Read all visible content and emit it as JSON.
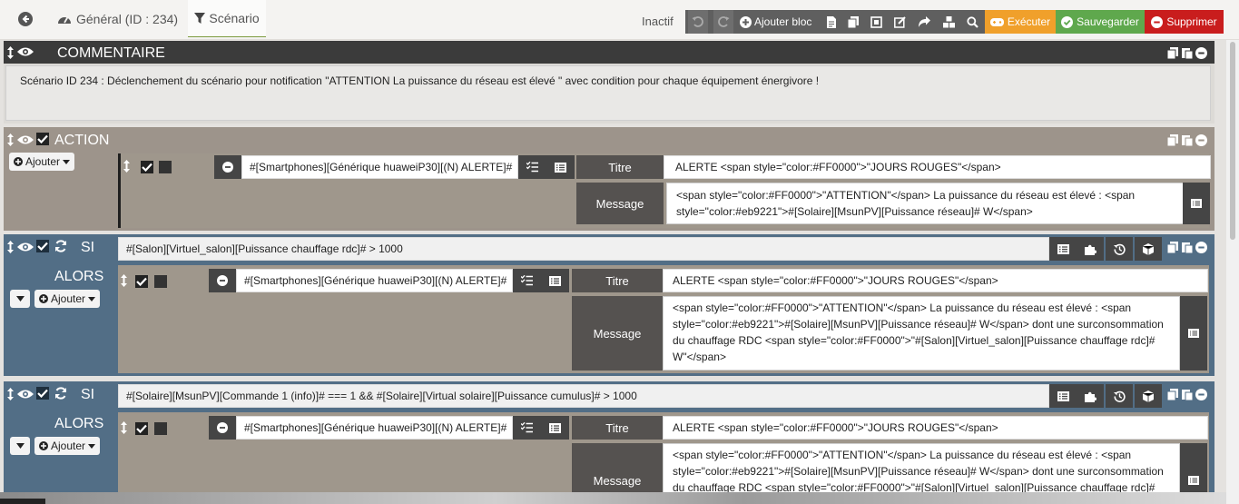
{
  "tabs": {
    "general": "Général (ID : 234)",
    "scenario": "Scénario"
  },
  "toolbar": {
    "status": "Inactif",
    "add_block": "Ajouter bloc",
    "execute": "Exécuter",
    "save": "Sauvegarder",
    "delete": "Supprimer"
  },
  "comment_block": {
    "title": "COMMENTAIRE",
    "text": "Scénario ID 234 : Déclenchement du scénario pour notification \"ATTENTION La puissance du réseau est élevé \" avec condition pour chaque équipement énergivore !"
  },
  "action_block": {
    "title": "ACTION",
    "add_label": "Ajouter",
    "command": "#[Smartphones][Générique huaweiP30][(N) ALERTE]#",
    "title_label": "Titre",
    "title_value": "ALERTE <span style=\"color:#FF0000\">\"JOURS ROUGES\"</span>",
    "message_label": "Message",
    "message_value": "<span style=\"color:#FF0000\">\"ATTENTION\"</span> La puissance du réseau est élevé : <span style=\"color:#eb9221\">#[Solaire][MsunPV][Puissance réseau]# W</span>"
  },
  "if_block_1": {
    "si_label": "SI",
    "alors_label": "ALORS",
    "add_label": "Ajouter",
    "condition": "#[Salon][Virtuel_salon][Puissance chauffage rdc]# > 1000",
    "command": "#[Smartphones][Générique huaweiP30][(N) ALERTE]#",
    "title_label": "Titre",
    "title_value": "ALERTE <span style=\"color:#FF0000\">\"JOURS ROUGES\"</span>",
    "message_label": "Message",
    "message_value": "<span style=\"color:#FF0000\">\"ATTENTION\"</span> La puissance du réseau est élevé : <span style=\"color:#eb9221\">#[Solaire][MsunPV][Puissance réseau]# W</span> dont une surconsommation du chauffage RDC <span style=\"color:#FF0000\">\"#[Salon][Virtuel_salon][Puissance chauffage rdc]# W\"</span>"
  },
  "if_block_2": {
    "si_label": "SI",
    "alors_label": "ALORS",
    "add_label": "Ajouter",
    "condition": "#[Solaire][MsunPV][Commande 1 (info)]# === 1 && #[Solaire][Virtual solaire][Puissance cumulus]# > 1000",
    "command": "#[Smartphones][Générique huaweiP30][(N) ALERTE]#",
    "title_label": "Titre",
    "title_value": "ALERTE <span style=\"color:#FF0000\">\"JOURS ROUGES\"</span>",
    "message_label": "Message",
    "message_value": "<span style=\"color:#FF0000\">\"ATTENTION\"</span> La puissance du réseau est élevé : <span style=\"color:#eb9221\">#[Solaire][MsunPV][Puissance réseau]# W</span> dont une surconsommation du chauffage RDC <span style=\"color:#FF0000\">\"#[Salon][Virtuel_salon][Puissance chauffage rdc]# W\"</span>"
  },
  "colors": {
    "comment_header": "#3b3b3b",
    "action_block": "#9d948b",
    "if_block": "#526e86",
    "inner_panel": "#9f978c",
    "execute": "#f0a02b",
    "save": "#5fa84d",
    "delete": "#c91d1d"
  }
}
